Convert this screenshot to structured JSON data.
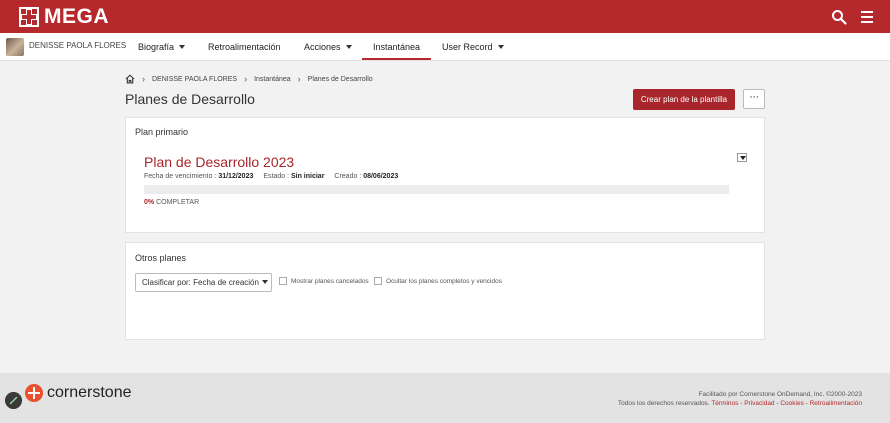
{
  "brand": {
    "name": "MEGA",
    "accent": "#b5282b"
  },
  "navbar": {
    "user_name": "DENISSE PAOLA FLORES",
    "items": [
      {
        "label": "Biografía",
        "dropdown": true
      },
      {
        "label": "Retroalimentación",
        "dropdown": false
      },
      {
        "label": "Acciones",
        "dropdown": true
      },
      {
        "label": "Instantánea",
        "dropdown": false,
        "active": true
      },
      {
        "label": "User Record",
        "dropdown": true
      }
    ]
  },
  "breadcrumb": [
    "DENISSE PAOLA FLORES",
    "Instantánea",
    "Planes de Desarrollo"
  ],
  "page": {
    "title": "Planes de Desarrollo",
    "create_button": "Crear plan de la plantilla",
    "more_button": "···"
  },
  "primary": {
    "section_title": "Plan primario",
    "plan_title": "Plan de Desarrollo 2023",
    "due_label": "Fecha de vencimiento :",
    "due_value": "31/12/2023",
    "status_label": "Estado :",
    "status_value": "Sin iniciar",
    "created_label": "Creado :",
    "created_value": "08/06/2023",
    "progress_fraction": 0,
    "progress_pct": "0%",
    "progress_suffix": "COMPLETAR"
  },
  "others": {
    "section_title": "Otros planes",
    "sort_label": "Clasificar por: Fecha de creación",
    "show_cancelled": "Mostrar planes cancelados",
    "hide_completed": "Ocultar los planes completos y vencidos"
  },
  "footer": {
    "logo_text": "cornerstone",
    "line1": "Facilitado por Cornerstone OnDemand, Inc. ©2000-2023",
    "rights": "Todos los derechos reservados.",
    "links": [
      "Términos",
      "Privacidad",
      "Cookies",
      "Retroalimentación"
    ]
  }
}
